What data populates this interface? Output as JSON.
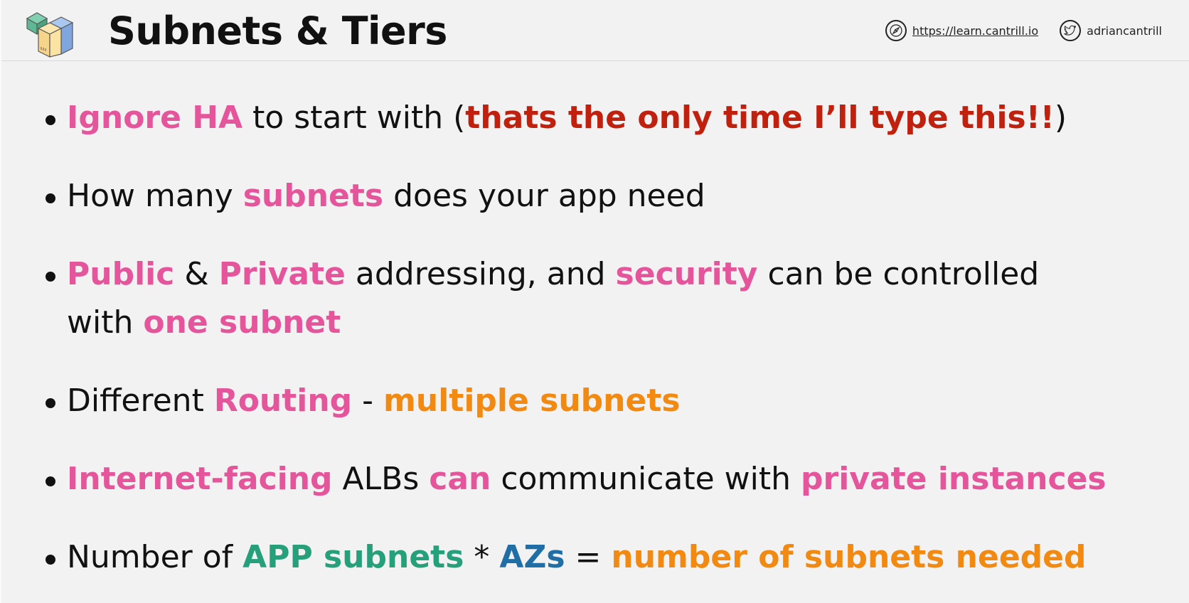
{
  "header": {
    "title": "Subnets & Tiers",
    "website": "https://learn.cantrill.io",
    "twitter": "adriancantrill",
    "logo_icon": "stacked-boxes-icon",
    "website_icon": "compass-icon",
    "twitter_icon": "twitter-bird-icon"
  },
  "colors": {
    "pink": "#e4559b",
    "red": "#c0200e",
    "orange": "#f28a12",
    "green": "#25a07a",
    "blue": "#1f6fa6",
    "background": "#f3f2f2"
  },
  "bullets": [
    {
      "segments": [
        {
          "text": "Ignore HA",
          "style": "pink"
        },
        {
          "text": " to start with (",
          "style": "plain"
        },
        {
          "text": "thats the only time I’ll type this!!",
          "style": "red"
        },
        {
          "text": ")",
          "style": "plain"
        }
      ]
    },
    {
      "segments": [
        {
          "text": "How many ",
          "style": "plain"
        },
        {
          "text": "subnets",
          "style": "pink"
        },
        {
          "text": " does your app need",
          "style": "plain"
        }
      ]
    },
    {
      "segments": [
        {
          "text": "Public",
          "style": "pink"
        },
        {
          "text": " & ",
          "style": "plain"
        },
        {
          "text": "Private",
          "style": "pink"
        },
        {
          "text": " addressing, and ",
          "style": "plain"
        },
        {
          "text": "security",
          "style": "pink"
        },
        {
          "text": " can be controlled",
          "style": "plain"
        },
        {
          "text": "with ",
          "style": "plain"
        },
        {
          "text": "one subnet",
          "style": "pink"
        }
      ]
    },
    {
      "segments": [
        {
          "text": "Different ",
          "style": "plain"
        },
        {
          "text": "Routing",
          "style": "pink"
        },
        {
          "text": " - ",
          "style": "plain"
        },
        {
          "text": "multiple subnets",
          "style": "orange"
        }
      ]
    },
    {
      "segments": [
        {
          "text": "Internet-facing",
          "style": "pink"
        },
        {
          "text": " ALBs ",
          "style": "plain"
        },
        {
          "text": "can",
          "style": "pink"
        },
        {
          "text": " communicate with ",
          "style": "plain"
        },
        {
          "text": "private instances",
          "style": "pink"
        }
      ]
    },
    {
      "segments": [
        {
          "text": "Number of ",
          "style": "plain"
        },
        {
          "text": "APP subnets",
          "style": "green"
        },
        {
          "text": " * ",
          "style": "plain"
        },
        {
          "text": "AZs",
          "style": "blue"
        },
        {
          "text": " = ",
          "style": "plain"
        },
        {
          "text": "number of subnets needed",
          "style": "orange"
        }
      ]
    }
  ]
}
